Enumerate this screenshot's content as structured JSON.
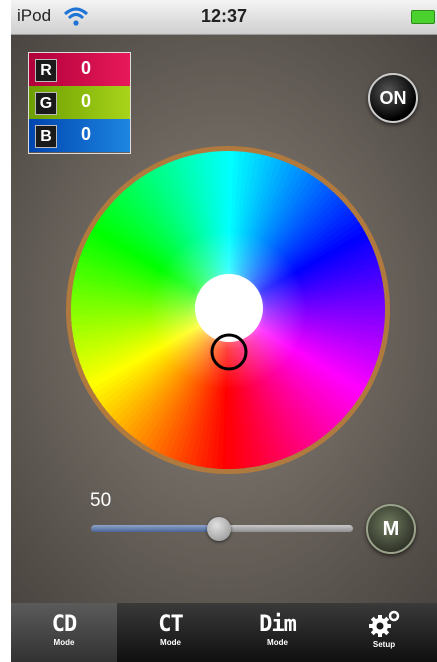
{
  "status_bar": {
    "carrier": "iPod",
    "time": "12:37"
  },
  "rgb": [
    {
      "letter": "R",
      "value": "0"
    },
    {
      "letter": "G",
      "value": "0"
    },
    {
      "letter": "B",
      "value": "0"
    }
  ],
  "power_button": {
    "label": "ON"
  },
  "brightness": {
    "value": "50",
    "fraction": 0.5
  },
  "memory_button": {
    "label": "M"
  },
  "tabs": [
    {
      "label": "CD",
      "sub": "Mode"
    },
    {
      "label": "CT",
      "sub": "Mode"
    },
    {
      "label": "Dim",
      "sub": "Mode"
    },
    {
      "label": "",
      "sub": "Setup"
    }
  ],
  "colors": {
    "rim": "#b07a3e",
    "battery": "#4ad12e"
  }
}
